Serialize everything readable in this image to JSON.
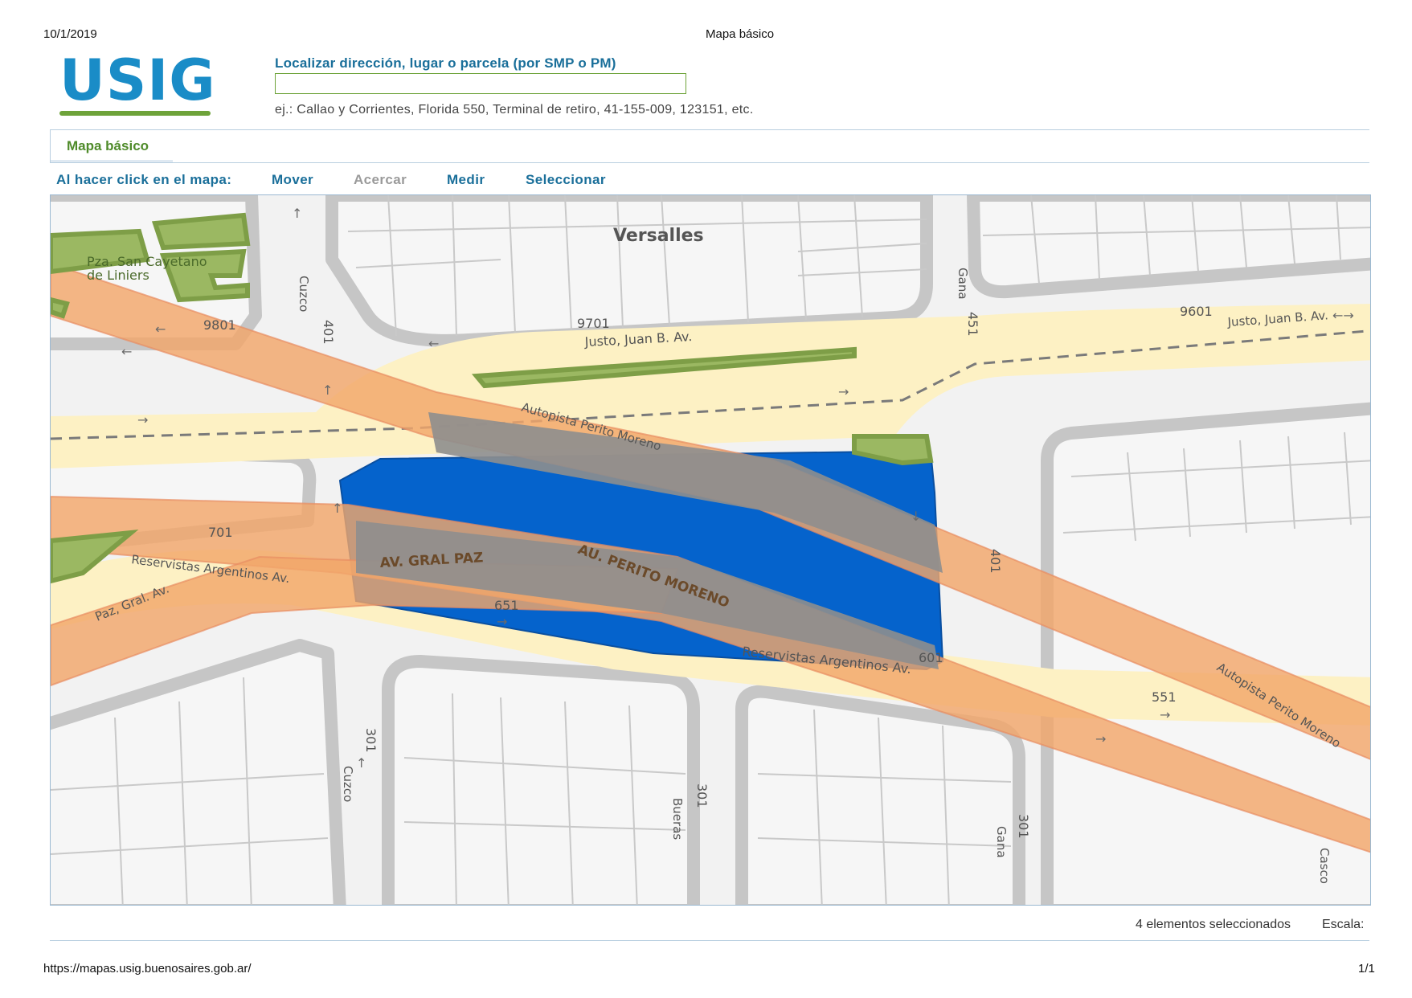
{
  "print_header": {
    "date": "10/1/2019",
    "title": "Mapa básico"
  },
  "logo": {
    "text": "USIG"
  },
  "search": {
    "label": "Localizar dirección, lugar o parcela (por SMP o PM)",
    "value": "",
    "hint": "ej.: Callao y Corrientes, Florida 550, Terminal de retiro, 41-155-009, 123151, etc."
  },
  "tabs": [
    {
      "label": "Mapa básico",
      "active": true
    }
  ],
  "toolbar": {
    "prompt": "Al hacer click en el mapa:",
    "tools": [
      {
        "label": "Mover",
        "enabled": true
      },
      {
        "label": "Acercar",
        "enabled": false
      },
      {
        "label": "Medir",
        "enabled": true
      },
      {
        "label": "Seleccionar",
        "enabled": true
      }
    ]
  },
  "map": {
    "neighborhood": "Versalles",
    "plaza": [
      "Pza. San Cayetano",
      "de Liniers"
    ],
    "streets": {
      "justo": "Justo, Juan B. Av.",
      "justo_right": "Justo, Juan B. Av.",
      "autopista_top": "Autopista Perito Moreno",
      "autopista_right": "Autopista Perito Moreno",
      "au_perito": "AU. PERITO MORENO",
      "gral_paz": "AV. GRAL PAZ",
      "paz": "Paz, Gral. Av.",
      "reservistas_left": "Reservistas Argentinos Av.",
      "reservistas_right": "Reservistas Argentinos Av.",
      "cuzco_top": "Cuzco",
      "cuzco_bottom": "Cuzco",
      "gana_top": "Gana",
      "gana_bottom": "Gana",
      "bueras": "Bueras",
      "casco": "Casco"
    },
    "numbers": {
      "n9801": "9801",
      "n9701": "9701",
      "n9601": "9601",
      "n401a": "401",
      "n451": "451",
      "n401b": "401",
      "n701": "701",
      "n651": "651",
      "n601": "601",
      "n551": "551",
      "n301a": "301",
      "n301b": "301",
      "n301c": "301"
    },
    "colors": {
      "selection": "#0563cc",
      "highway": "#f2a66a",
      "avenue": "#fdf1c4",
      "park": "#8fb05a",
      "block": "#c6c6c6"
    }
  },
  "status": {
    "selected": "4 elementos seleccionados",
    "scale_label": "Escala:"
  },
  "footer": {
    "url": "https://mapas.usig.buenosaires.gob.ar/",
    "page": "1/1"
  }
}
